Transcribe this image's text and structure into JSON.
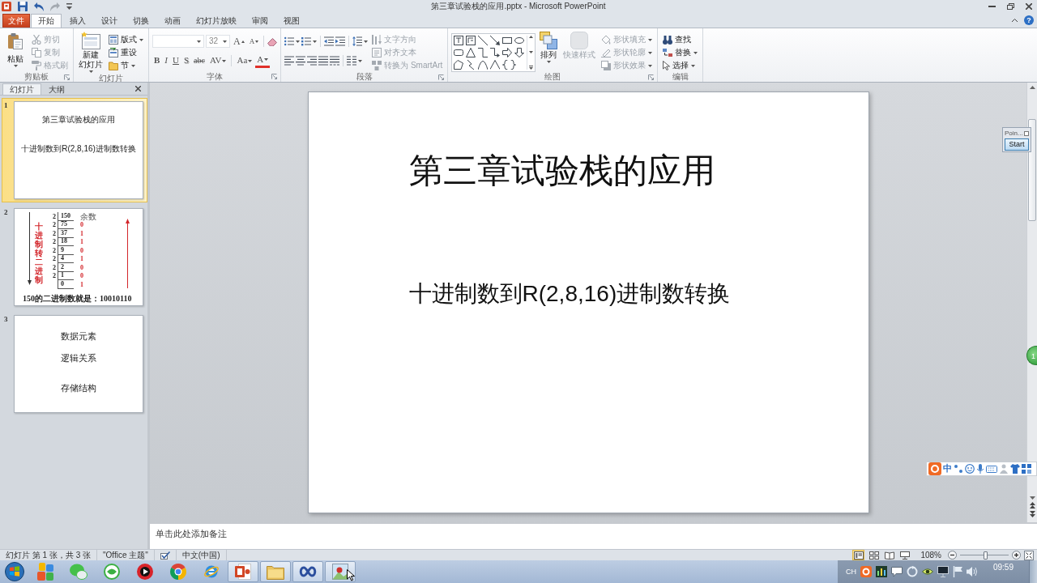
{
  "window": {
    "title": "第三章试验栈的应用.pptx - Microsoft PowerPoint"
  },
  "quick_access": [
    {
      "disabled": false
    },
    {
      "disabled": false
    },
    {
      "disabled": true
    },
    {
      "disabled": false
    }
  ],
  "ribbon_tabs": [
    {
      "label": "文件",
      "kind": "backstage",
      "selected": false
    },
    {
      "label": "开始",
      "kind": "tab",
      "selected": true
    },
    {
      "label": "插入",
      "kind": "tab",
      "selected": false
    },
    {
      "label": "设计",
      "kind": "tab",
      "selected": false
    },
    {
      "label": "切换",
      "kind": "tab",
      "selected": false
    },
    {
      "label": "动画",
      "kind": "tab",
      "selected": false
    },
    {
      "label": "幻灯片放映",
      "kind": "tab",
      "selected": false
    },
    {
      "label": "审阅",
      "kind": "tab",
      "selected": false
    },
    {
      "label": "视图",
      "kind": "tab",
      "selected": false
    }
  ],
  "ribbon_help": {
    "label": "?"
  },
  "ribbon": {
    "clipboard": {
      "label": "剪贴板",
      "paste": {
        "label": "粘贴"
      },
      "commands": [
        {
          "label": "剪切",
          "disabled": true
        },
        {
          "label": "复制",
          "disabled": true
        },
        {
          "label": "格式刷",
          "disabled": true
        }
      ]
    },
    "slides": {
      "label": "幻灯片",
      "new_slide": {
        "lines": [
          "新建",
          "幻灯片"
        ]
      },
      "commands": [
        {
          "label": "版式",
          "dropdown": true
        },
        {
          "label": "重设",
          "dropdown": false
        },
        {
          "label": "节",
          "dropdown": true
        }
      ]
    },
    "font": {
      "label": "字体",
      "font_size": "32",
      "size_buttons": [
        "A",
        "A"
      ],
      "format_buttons": [
        "B",
        "I",
        "U",
        "S",
        "abc",
        "AV",
        "Aa",
        "A"
      ]
    },
    "paragraph": {
      "label": "段落",
      "commands": [
        {
          "label": "文字方向",
          "disabled": true
        },
        {
          "label": "对齐文本",
          "disabled": true
        },
        {
          "label": "转换为 SmartArt",
          "disabled": true
        }
      ]
    },
    "drawing": {
      "label": "绘图",
      "arrange": {
        "label": "排列"
      },
      "quick_styles": {
        "label": "快速样式",
        "disabled": true
      },
      "commands": [
        {
          "label": "形状填充",
          "disabled": true
        },
        {
          "label": "形状轮廓",
          "disabled": true
        },
        {
          "label": "形状效果",
          "disabled": true
        }
      ]
    },
    "editing": {
      "label": "编辑",
      "commands": [
        {
          "label": "查找",
          "dropdown": false
        },
        {
          "label": "替换",
          "dropdown": true
        },
        {
          "label": "选择",
          "dropdown": true
        }
      ]
    }
  },
  "panel_tabs": [
    {
      "label": "幻灯片",
      "selected": true
    },
    {
      "label": "大纲",
      "selected": false
    }
  ],
  "slides": [
    {
      "number": "1",
      "selected": true,
      "kind": "title",
      "title": "第三章试验栈的应用",
      "subtitle": "十进制数到R(2,8,16)进制数转换"
    },
    {
      "number": "2",
      "selected": false,
      "kind": "division",
      "label": "十进制转二进制",
      "header": "余数",
      "rows": [
        {
          "divisor": "2",
          "value": "150"
        },
        {
          "divisor": "2",
          "value": "75",
          "remainder": "0"
        },
        {
          "divisor": "2",
          "value": "37",
          "remainder": "1"
        },
        {
          "divisor": "2",
          "value": "18",
          "remainder": "1"
        },
        {
          "divisor": "2",
          "value": "9",
          "remainder": "0"
        },
        {
          "divisor": "2",
          "value": "4",
          "remainder": "1"
        },
        {
          "divisor": "2",
          "value": "2",
          "remainder": "0"
        },
        {
          "divisor": "2",
          "value": "1",
          "remainder": "0"
        },
        {
          "value": "0",
          "remainder": "1"
        }
      ],
      "result": "150的二进制数就是：10010110"
    },
    {
      "number": "3",
      "selected": false,
      "kind": "list",
      "lines": [
        "数据元素",
        "逻辑关系",
        "存储结构"
      ]
    }
  ],
  "slide": {
    "title": "第三章试验栈的应用",
    "subtitle": "十进制数到R(2,8,16)进制数转换"
  },
  "notes": {
    "placeholder": "单击此处添加备注"
  },
  "status_bar": {
    "slide_info": "幻灯片 第 1 张，共 3 张",
    "theme": "\"Office 主题\"",
    "language": "中文(中国)",
    "views": [
      {
        "selected": true
      },
      {
        "selected": false
      },
      {
        "selected": false
      },
      {
        "selected": false
      }
    ],
    "zoom": "108%",
    "zoom_slider": {
      "level": 0.52
    }
  },
  "taskbar": {
    "apps": [
      {
        "running": false
      },
      {
        "running": false
      },
      {
        "running": false
      },
      {
        "running": false
      },
      {
        "running": false
      },
      {
        "running": false
      },
      {
        "running": true
      },
      {
        "running": true
      },
      {
        "running": true
      },
      {
        "running": true
      }
    ],
    "tray": {
      "language": "CH",
      "clock": "09:59"
    }
  },
  "pointer_panel": {
    "title": "Poin...",
    "button": "Start"
  },
  "page_badge": {
    "text": "1"
  },
  "ime_bar": {
    "mode": "中"
  }
}
